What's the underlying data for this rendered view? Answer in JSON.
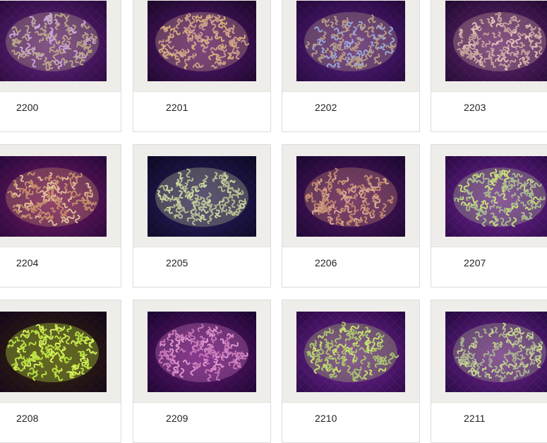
{
  "products": [
    {
      "id": "2200",
      "palette": {
        "bg": "#2a0a3c",
        "coral": "#b8a48a",
        "tip": "#c9a6d8",
        "glow": "#6a2a8a"
      }
    },
    {
      "id": "2201",
      "palette": {
        "bg": "#1c0828",
        "coral": "#c99a8a",
        "tip": "#d8b07a",
        "glow": "#5a1a7a"
      }
    },
    {
      "id": "2202",
      "palette": {
        "bg": "#24093a",
        "coral": "#b49c84",
        "tip": "#9aa8d8",
        "glow": "#5c2288"
      }
    },
    {
      "id": "2203",
      "palette": {
        "bg": "#220a30",
        "coral": "#c4a09c",
        "tip": "#e0c0b8",
        "glow": "#6a2a7a"
      }
    },
    {
      "id": "2204",
      "palette": {
        "bg": "#260a3a",
        "coral": "#c48c6c",
        "tip": "#e0c09a",
        "glow": "#7a1a6a"
      }
    },
    {
      "id": "2205",
      "palette": {
        "bg": "#0c0a22",
        "coral": "#b4b890",
        "tip": "#c8d8a0",
        "glow": "#30206a"
      }
    },
    {
      "id": "2206",
      "palette": {
        "bg": "#1a0830",
        "coral": "#c08870",
        "tip": "#d8a890",
        "glow": "#5a1a6a"
      }
    },
    {
      "id": "2207",
      "palette": {
        "bg": "#2a0a44",
        "coral": "#a8b890",
        "tip": "#c8e078",
        "glow": "#7a2aa0"
      }
    },
    {
      "id": "2208",
      "palette": {
        "bg": "#14061a",
        "coral": "#b8e040",
        "tip": "#d8f060",
        "glow": "#3a2a10"
      }
    },
    {
      "id": "2209",
      "palette": {
        "bg": "#1a0630",
        "coral": "#c878b8",
        "tip": "#e098d0",
        "glow": "#6a1a7a"
      }
    },
    {
      "id": "2210",
      "palette": {
        "bg": "#2a0a44",
        "coral": "#a8c070",
        "tip": "#c8e070",
        "glow": "#7a2aa0"
      }
    },
    {
      "id": "2211",
      "palette": {
        "bg": "#240a40",
        "coral": "#a8b090",
        "tip": "#c8d890",
        "glow": "#7a2a9a"
      }
    }
  ]
}
